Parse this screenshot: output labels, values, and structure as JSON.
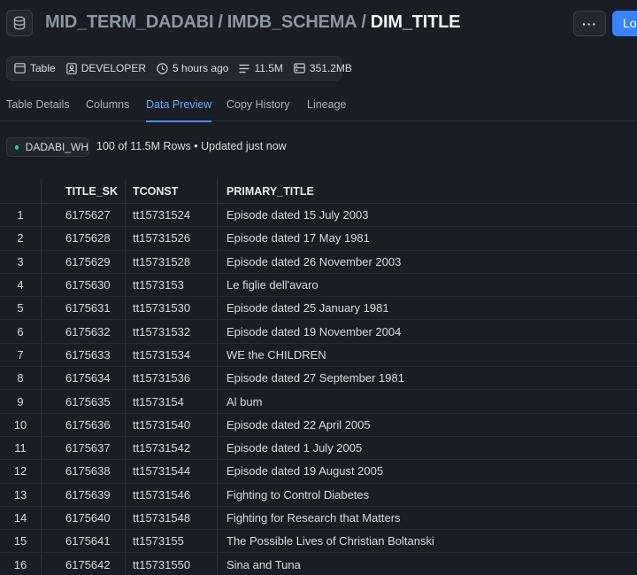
{
  "header": {
    "breadcrumb": [
      "MID_TERM_DADABI",
      "IMDB_SCHEMA"
    ],
    "separator": "/",
    "current": "DIM_TITLE",
    "more_label": "···",
    "primary_label": "Lo"
  },
  "meta": {
    "type": "Table",
    "owner": "DEVELOPER",
    "updated": "5 hours ago",
    "rows": "11.5M",
    "size": "351.2MB"
  },
  "tabs": [
    "Table Details",
    "Columns",
    "Data Preview",
    "Copy History",
    "Lineage"
  ],
  "active_tab": "Data Preview",
  "warehouse": "DADABI_WH",
  "row_info": "100 of 11.5M Rows • Updated just now",
  "colors": {
    "accent": "#4f8ff7",
    "primary_button": "#3b82f6",
    "warehouse_dot": "#37c98b",
    "background": "#1a1d23"
  },
  "table": {
    "columns": [
      "TITLE_SK",
      "TCONST",
      "PRIMARY_TITLE"
    ],
    "rows": [
      {
        "idx": "1",
        "sk": "6175627",
        "tconst": "tt15731524",
        "title": "Episode dated 15 July 2003"
      },
      {
        "idx": "2",
        "sk": "6175628",
        "tconst": "tt15731526",
        "title": "Episode dated 17 May 1981"
      },
      {
        "idx": "3",
        "sk": "6175629",
        "tconst": "tt15731528",
        "title": "Episode dated 26 November 2003"
      },
      {
        "idx": "4",
        "sk": "6175630",
        "tconst": "tt1573153",
        "title": "Le figlie dell'avaro"
      },
      {
        "idx": "5",
        "sk": "6175631",
        "tconst": "tt15731530",
        "title": "Episode dated 25 January 1981"
      },
      {
        "idx": "6",
        "sk": "6175632",
        "tconst": "tt15731532",
        "title": "Episode dated 19 November 2004"
      },
      {
        "idx": "7",
        "sk": "6175633",
        "tconst": "tt15731534",
        "title": "WE the CHILDREN"
      },
      {
        "idx": "8",
        "sk": "6175634",
        "tconst": "tt15731536",
        "title": "Episode dated 27 September 1981"
      },
      {
        "idx": "9",
        "sk": "6175635",
        "tconst": "tt1573154",
        "title": "Al bum"
      },
      {
        "idx": "10",
        "sk": "6175636",
        "tconst": "tt15731540",
        "title": "Episode dated 22 April 2005"
      },
      {
        "idx": "11",
        "sk": "6175637",
        "tconst": "tt15731542",
        "title": "Episode dated 1 July 2005"
      },
      {
        "idx": "12",
        "sk": "6175638",
        "tconst": "tt15731544",
        "title": "Episode dated 19 August 2005"
      },
      {
        "idx": "13",
        "sk": "6175639",
        "tconst": "tt15731546",
        "title": "Fighting to Control Diabetes"
      },
      {
        "idx": "14",
        "sk": "6175640",
        "tconst": "tt15731548",
        "title": "Fighting for Research that Matters"
      },
      {
        "idx": "15",
        "sk": "6175641",
        "tconst": "tt1573155",
        "title": "The Possible Lives of Christian Boltanski"
      },
      {
        "idx": "16",
        "sk": "6175642",
        "tconst": "tt15731550",
        "title": "Sina and Tuna"
      }
    ]
  }
}
